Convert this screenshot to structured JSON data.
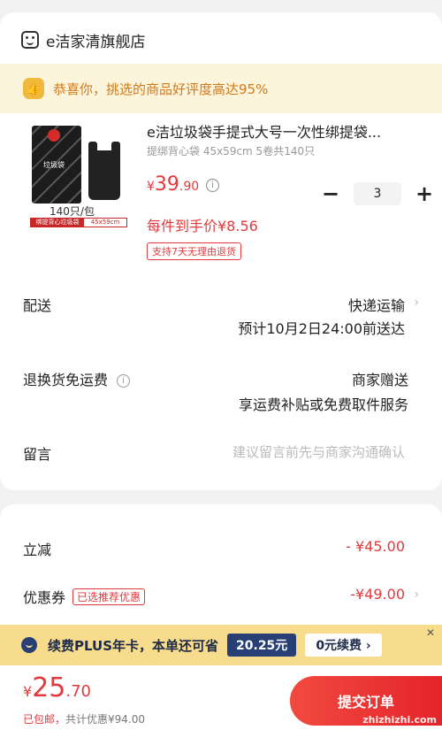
{
  "shop": {
    "name": "e洁家清旗舰店"
  },
  "banner": {
    "text": "恭喜你，挑选的商品好评度高达95%"
  },
  "product": {
    "image_count_label": "140只/包",
    "image_tag_left": "绑提背心垃圾袋",
    "image_tag_right": "45x59cm",
    "image_pack_text": "垃圾袋",
    "title": "e洁垃圾袋手提式大号一次性绑提袋...",
    "subtitle": "提绑背心袋 45x59cm 5卷共140只",
    "price_symbol": "¥",
    "price_int": "39",
    "price_dec": ".90",
    "unit_price": "每件到手价¥8.56",
    "return_badge": "支持7天无理由退货",
    "quantity": "3",
    "minus": "−",
    "plus": "+"
  },
  "delivery": {
    "label": "配送",
    "method": "快递运输",
    "eta": "预计10月2日24:00前送达"
  },
  "return_shipping": {
    "label": "退换货免运费",
    "provider": "商家赠送",
    "detail": "享运费补贴或免费取件服务"
  },
  "note": {
    "label": "留言",
    "placeholder": "建议留言前先与商家沟通确认"
  },
  "discounts": {
    "instant_label": "立减",
    "instant_value": "- ¥45.00",
    "coupon_label": "优惠券",
    "coupon_tag": "已选推荐优惠",
    "coupon_value": "-¥49.00"
  },
  "plus_bar": {
    "text": "续费PLUS年卡，本单还可省",
    "amount": "20.25元",
    "action": "0元续费 ›",
    "close": "✕"
  },
  "footer": {
    "total_symbol": "¥",
    "total_int": "25",
    "total_dec": ".70",
    "shipping": "已包邮，",
    "savings": "共计优惠¥94.00",
    "submit": "提交订单",
    "watermark": "zhizhizhi.com"
  },
  "colors": {
    "accent": "#e4393c",
    "banner_bg": "#fdf4dc",
    "plus_bg": "#f6dc8c",
    "plus_dark": "#283f76"
  }
}
